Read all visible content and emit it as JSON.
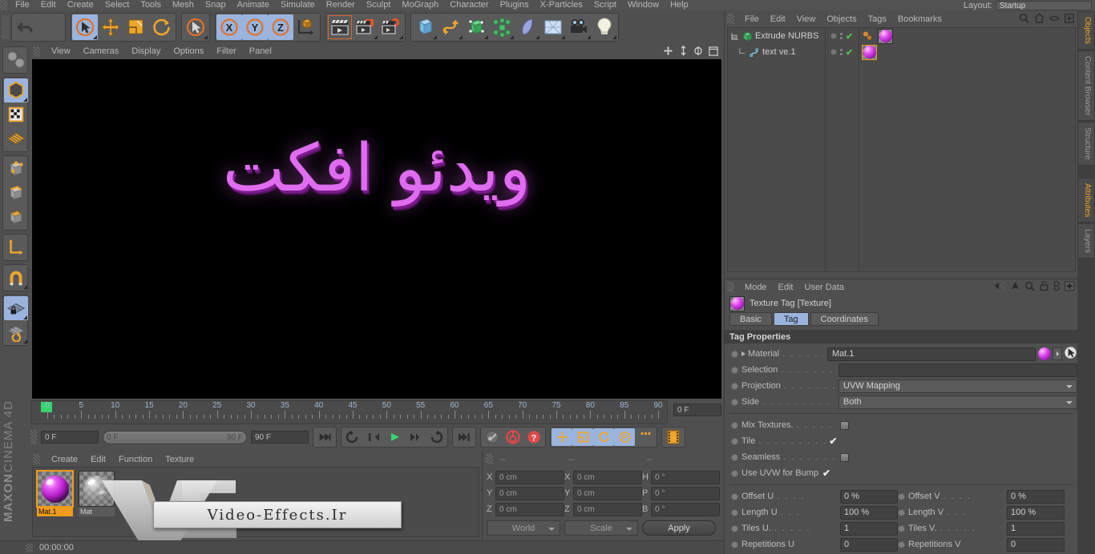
{
  "menubar": {
    "items": [
      "File",
      "Edit",
      "Create",
      "Select",
      "Tools",
      "Mesh",
      "Snap",
      "Animate",
      "Simulate",
      "Render",
      "Sculpt",
      "MoGraph",
      "Character",
      "Plugins",
      "X-Particles",
      "Script",
      "Window",
      "Help"
    ],
    "layout_label": "Layout:",
    "layout_value": "Startup"
  },
  "viewport": {
    "menu": [
      "View",
      "Cameras",
      "Display",
      "Options",
      "Filter",
      "Panel"
    ],
    "scene_text": "ویدئو افکت",
    "text_color": "#e06cf0"
  },
  "timeline": {
    "ticks": [
      "0",
      "5",
      "10",
      "15",
      "20",
      "25",
      "30",
      "35",
      "40",
      "45",
      "50",
      "55",
      "60",
      "65",
      "70",
      "75",
      "80",
      "85",
      "90"
    ],
    "current_frame_field": "0 F",
    "range_start": "0 F",
    "range_end": "90 F",
    "max_frame_field": "90 F",
    "end_time_field": "0 F"
  },
  "material_manager": {
    "menu": [
      "Create",
      "Edit",
      "Function",
      "Texture"
    ],
    "materials": [
      {
        "name": "Mat.1",
        "selected": true
      },
      {
        "name": "Mat",
        "selected": false
      }
    ],
    "watermark_text": "Video-Effects.Ir"
  },
  "coordinates": {
    "headers": [
      "--",
      "--",
      "--"
    ],
    "position": {
      "x": "0 cm",
      "y": "0 cm",
      "z": "0 cm"
    },
    "size": {
      "x": "0 cm",
      "y": "0 cm",
      "z": "0 cm"
    },
    "rotation": {
      "h": "0 °",
      "p": "0 °",
      "b": "0 °"
    },
    "axis_labels": {
      "x": "X",
      "y": "Y",
      "z": "Z",
      "h": "H",
      "p": "P",
      "b": "B"
    },
    "space_select": "World",
    "mode_select": "Scale",
    "apply_label": "Apply"
  },
  "statusbar": {
    "timecode": "00:00:00"
  },
  "object_manager": {
    "menu": [
      "File",
      "Edit",
      "View",
      "Objects",
      "Tags",
      "Bookmarks"
    ],
    "objects": [
      {
        "name": "Extrude NURBS",
        "depth": 0
      },
      {
        "name": "text ve.1",
        "depth": 1
      }
    ]
  },
  "attributes": {
    "menu": [
      "Mode",
      "Edit",
      "User Data"
    ],
    "title": "Texture Tag [Texture]",
    "tabs": [
      {
        "label": "Basic",
        "active": false
      },
      {
        "label": "Tag",
        "active": true
      },
      {
        "label": "Coordinates",
        "active": false
      }
    ],
    "section": "Tag Properties",
    "rows": [
      {
        "label": "Material",
        "dots": ". . . . . . .",
        "type": "material",
        "value": "Mat.1"
      },
      {
        "label": "Selection",
        "dots": ". . . . . . . .",
        "type": "field",
        "value": ""
      },
      {
        "label": "Projection",
        "dots": ". . . . . . .",
        "type": "dropdown",
        "value": "UVW Mapping"
      },
      {
        "label": "Side",
        "dots": ". . . . . . . . . . .",
        "type": "dropdown",
        "value": "Both"
      }
    ],
    "checks": [
      {
        "label": "Mix Textures.",
        "dots": ". . . . . .",
        "checked": false
      },
      {
        "label": "Tile",
        "dots": ". . . . . . . . . . . .",
        "checked": true
      },
      {
        "label": "Seamless",
        "dots": ". . . . . . . .",
        "checked": false
      },
      {
        "label": "Use UVW for Bump",
        "dots": "",
        "checked": true
      }
    ],
    "numeric_rows": [
      {
        "left_label": "Offset U",
        "left_dots": ". . . .",
        "left_value": "0 %",
        "right_label": "Offset V",
        "right_dots": ". . . .",
        "right_value": "0 %"
      },
      {
        "left_label": "Length U",
        "left_dots": ". . .",
        "left_value": "100 %",
        "right_label": "Length V",
        "right_dots": ". . .",
        "right_value": "100 %"
      },
      {
        "left_label": "Tiles U.",
        "left_dots": ". . . . .",
        "left_value": "1",
        "right_label": "Tiles V.",
        "right_dots": ". . . . .",
        "right_value": "1"
      },
      {
        "left_label": "Repetitions U",
        "left_dots": "",
        "left_value": "0",
        "right_label": "Repetitions V",
        "right_dots": "",
        "right_value": "0"
      }
    ]
  },
  "right_tabs_top": [
    {
      "label": "Objects",
      "active": true
    },
    {
      "label": "Content Browser",
      "active": false
    },
    {
      "label": "Structure",
      "active": false
    }
  ],
  "right_tabs_bottom": [
    {
      "label": "Attributes",
      "active": true
    },
    {
      "label": "Layers",
      "active": false
    }
  ],
  "branding": {
    "maxon": "MAXON",
    "c4d": "CINEMA 4D"
  }
}
